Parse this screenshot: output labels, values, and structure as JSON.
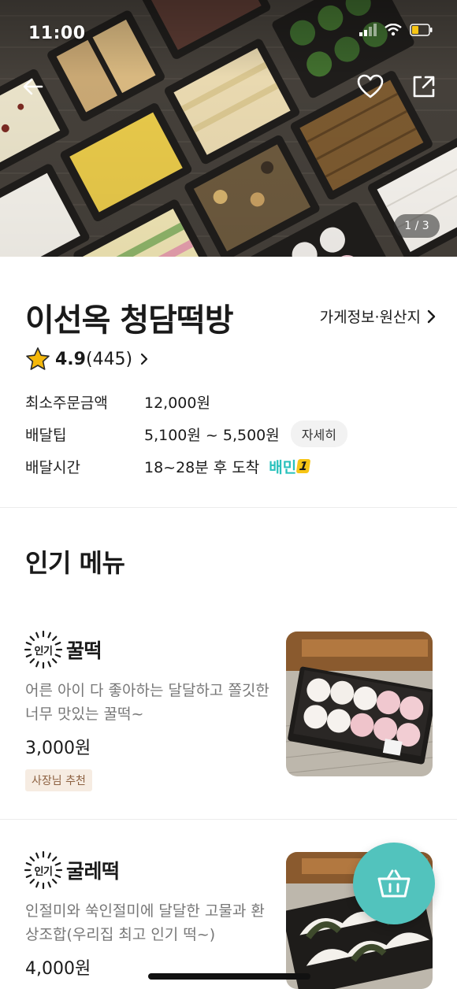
{
  "status_bar": {
    "time": "11:00"
  },
  "hero": {
    "page_counter": "1 / 3"
  },
  "store": {
    "name": "이선옥 청담떡방",
    "info_link": "가게정보·원산지",
    "rating": {
      "score": "4.9",
      "count": "(445)",
      "star_color": "#f5b80a"
    },
    "min_order": {
      "label": "최소주문금액",
      "value": "12,000원"
    },
    "delivery_tip": {
      "label": "배달팁",
      "value": "5,100원 ~ 5,500원",
      "detail_button": "자세히"
    },
    "delivery_time": {
      "label": "배달시간",
      "value": "18~28분 후 도착",
      "service_badge": "배민",
      "service_badge_num": "1"
    }
  },
  "popular_menu": {
    "title": "인기 메뉴",
    "popular_badge": "인기",
    "items": [
      {
        "name": "꿀떡",
        "description": "어른 아이 다 좋아하는 달달하고 쫄깃한 너무 맛있는 꿀떡~",
        "price": "3,000원",
        "tag": "사장님 추천"
      },
      {
        "name": "굴레떡",
        "description": "인절미와 쑥인절미에 달달한 고물과 환상조합(우리집 최고 인기 떡~)",
        "price": "4,000원"
      }
    ]
  },
  "theme": {
    "accent": "#2ac1bc",
    "fab": "#52c3bd",
    "tag_bg": "#f6ece2",
    "tag_text": "#8c6040"
  }
}
